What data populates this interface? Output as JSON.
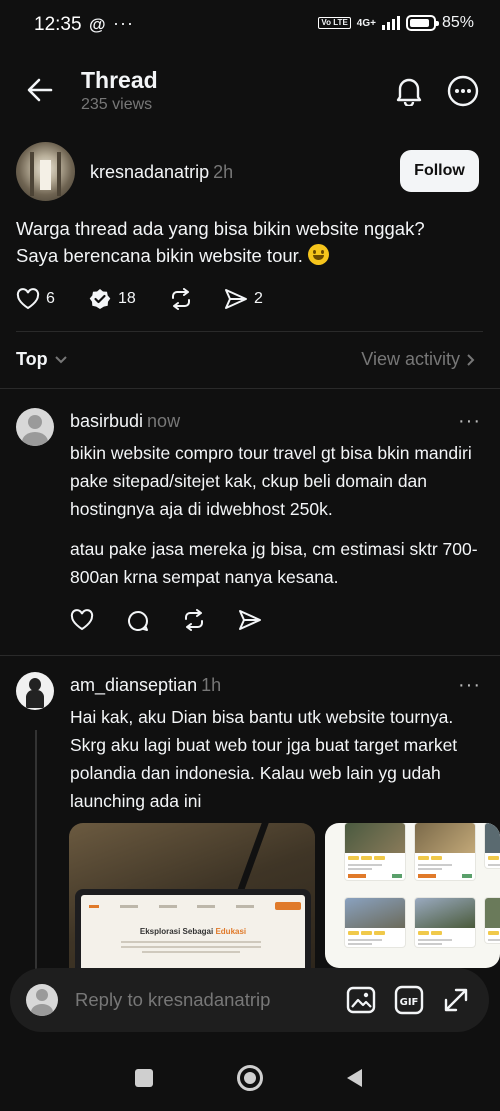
{
  "status_bar": {
    "time": "12:35",
    "threads_glyph": "@",
    "dots": "···",
    "volte": "Vo LTE",
    "network": "4G+",
    "battery": "85%"
  },
  "header": {
    "title": "Thread",
    "views": "235 views"
  },
  "post": {
    "username": "kresnadanatrip",
    "time_ago": "2h",
    "follow_label": "Follow",
    "text_line1": "Warga thread ada yang bisa bikin website nggak?",
    "text_line2": "Saya berencana bikin website tour.",
    "likes": "6",
    "replies": "18",
    "shares": "2"
  },
  "sort": {
    "label": "Top",
    "view_activity": "View activity"
  },
  "replies": [
    {
      "username": "basirbudi",
      "time_ago": "now",
      "paragraph1": "bikin website compro tour travel gt bisa bkin mandiri pake sitepad/sitejet kak, ckup beli domain dan hostingnya aja di idwebhost 250k.",
      "paragraph2": "atau pake jasa mereka jg bisa, cm estimasi sktr 700-800an krna sempat nanya kesana."
    },
    {
      "username": "am_dianseptian",
      "time_ago": "1h",
      "paragraph1": "Hai kak, aku Dian bisa bantu utk website tournya. Skrg aku lagi buat web tour jga buat target market polandia dan indonesia. Kalau web lain yg udah launching ada ini",
      "screen_heading_a": "Eksplorasi Sebagai ",
      "screen_heading_b": "Edukasi"
    }
  ],
  "composer": {
    "placeholder": "Reply to kresnadanatrip"
  },
  "colors": {
    "background": "#101010",
    "text": "#f3f5f7",
    "muted": "#777777",
    "follow_bg": "#f3f5f7",
    "composer_bg": "#1e1e1e"
  }
}
